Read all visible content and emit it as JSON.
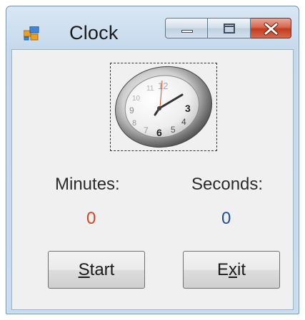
{
  "window": {
    "title": "Clock"
  },
  "clock": {
    "image": "analog-clock-icon"
  },
  "labels": {
    "minutes": "Minutes:",
    "seconds": "Seconds:"
  },
  "values": {
    "minutes": "0",
    "seconds": "0"
  },
  "buttons": {
    "start": {
      "mnemonic": "S",
      "rest": "tart"
    },
    "exit": {
      "pre": "E",
      "mnemonic": "x",
      "rest": "it"
    }
  },
  "colors": {
    "minutes_value": "#d2481c",
    "seconds_value": "#1c4ea3"
  }
}
